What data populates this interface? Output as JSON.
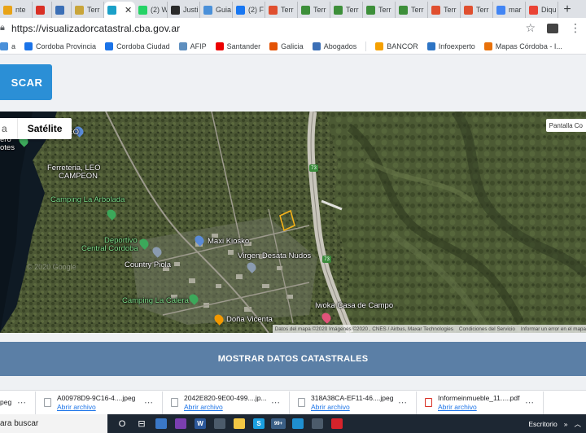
{
  "browser": {
    "tabs": [
      {
        "label": "nte",
        "icon": "tab-favicon",
        "color": "#e8a317",
        "active": false
      },
      {
        "label": "",
        "icon": "gmail-icon",
        "color": "#d93025",
        "active": false
      },
      {
        "label": "",
        "icon": "calendar-icon",
        "color": "#3b6fb6",
        "active": false
      },
      {
        "label": "Terr",
        "icon": "tab-favicon",
        "color": "#c9a53a",
        "active": false
      },
      {
        "label": "",
        "icon": "tab-favicon",
        "color": "#1aa0c8",
        "active": true
      },
      {
        "label": "(2) W",
        "icon": "whatsapp-icon",
        "color": "#25d366",
        "active": false
      },
      {
        "label": "Justi",
        "icon": "tab-favicon",
        "color": "#2a2a2a",
        "active": false
      },
      {
        "label": "Guia",
        "icon": "tab-favicon",
        "color": "#4a90d9",
        "active": false
      },
      {
        "label": "(2) F",
        "icon": "facebook-icon",
        "color": "#1877f2",
        "active": false
      },
      {
        "label": "Terr",
        "icon": "tab-favicon",
        "color": "#e04f2f",
        "active": false
      },
      {
        "label": "Terr",
        "icon": "tab-favicon",
        "color": "#3d8f3a",
        "active": false
      },
      {
        "label": "Terr",
        "icon": "tab-favicon",
        "color": "#3d8f3a",
        "active": false
      },
      {
        "label": "Terr",
        "icon": "tab-favicon",
        "color": "#3d8f3a",
        "active": false
      },
      {
        "label": "Terr",
        "icon": "tab-favicon",
        "color": "#3d8f3a",
        "active": false
      },
      {
        "label": "Terr",
        "icon": "tab-favicon",
        "color": "#e04f2f",
        "active": false
      },
      {
        "label": "Terr",
        "icon": "tab-favicon",
        "color": "#e04f2f",
        "active": false
      },
      {
        "label": "mar",
        "icon": "google-icon",
        "color": "#4285f4",
        "active": false
      },
      {
        "label": "Diqu",
        "icon": "maps-pin-icon",
        "color": "#ea4335",
        "active": false
      }
    ],
    "new_tab": "+",
    "url": "https://visualizadorcatastral.cba.gov.ar",
    "bookmarks": [
      {
        "label": "a",
        "color": "#4a90d9"
      },
      {
        "label": "Cordoba Provincia",
        "color": "#1a73e8"
      },
      {
        "label": "Cordoba Ciudad",
        "color": "#1a73e8"
      },
      {
        "label": "AFIP",
        "color": "#5f8fbf"
      },
      {
        "label": "Santander",
        "color": "#ec0000"
      },
      {
        "label": "Galicia",
        "color": "#e35205"
      },
      {
        "label": "Abogados",
        "color": "#3b6fb6"
      },
      {
        "label": "BANCOR",
        "color": "#f5a000"
      },
      {
        "label": "Infoexperto",
        "color": "#2d74c4"
      },
      {
        "label": "Mapas Córdoba - I...",
        "color": "#e8710a"
      }
    ]
  },
  "page": {
    "search_button": "SCAR",
    "map": {
      "type_unselected": "a",
      "type_selected": "Satélite",
      "fullscreen": "Pantalla Co",
      "labels": [
        {
          "text": "LEO",
          "style": ""
        },
        {
          "text": "Ferreteria, LEO",
          "style": ""
        },
        {
          "text": "CAMPEON",
          "style": ""
        },
        {
          "text": "Camping La Arbolada",
          "style": "green"
        },
        {
          "text": "Deportivo",
          "style": "green"
        },
        {
          "text": "Central Cordoba",
          "style": "green"
        },
        {
          "text": "Maxi Kiosko",
          "style": ""
        },
        {
          "text": "Virgen Desata Nudos",
          "style": ""
        },
        {
          "text": "Country Piola",
          "style": ""
        },
        {
          "text": "Camping La Calera",
          "style": "green"
        },
        {
          "text": "Doña Vicenta",
          "style": ""
        },
        {
          "text": "Iwoka Casa de Campo",
          "style": ""
        },
        {
          "text": "© 2020 Google",
          "style": "faint"
        },
        {
          "text": "ero",
          "style": ""
        },
        {
          "text": "otes",
          "style": ""
        }
      ],
      "route_shields": [
        "73",
        "73"
      ],
      "attribution": [
        "Datos del mapa ©2020 Imágenes ©2020 , CNES / Airbus, Maxar Technologies",
        "Condiciones del Servicio",
        "Informar un error en el mapa"
      ]
    },
    "show_data_button": "MOSTRAR DATOS CATASTRALES"
  },
  "downloads": [
    {
      "name": "peg",
      "open": ""
    },
    {
      "name": "A00978D9-9C16-4....jpeg",
      "open": "Abrir archivo"
    },
    {
      "name": "2042E820-9E00-499....jp...",
      "open": "Abrir archivo"
    },
    {
      "name": "318A38CA-EF11-46....jpeg",
      "open": "Abrir archivo"
    },
    {
      "name": "Informeinmueble_11.....pdf",
      "open": "Abrir archivo"
    }
  ],
  "taskbar": {
    "search_text": "ara buscar",
    "apps": [
      {
        "name": "cortana-icon",
        "glyph": "O",
        "color": ""
      },
      {
        "name": "task-view-icon",
        "glyph": "⊟",
        "color": ""
      },
      {
        "name": "calculator-icon",
        "glyph": "",
        "color": "#3a78c8"
      },
      {
        "name": "whatsapp-icon",
        "glyph": "",
        "color": "#7a3fb0"
      },
      {
        "name": "word-icon",
        "glyph": "W",
        "color": "#2b579a"
      },
      {
        "name": "phone-icon",
        "glyph": "",
        "color": "#4c5b6b"
      },
      {
        "name": "file-explorer-icon",
        "glyph": "",
        "color": "#f2c744"
      },
      {
        "name": "skype-icon",
        "glyph": "S",
        "color": "#1a9fe0"
      },
      {
        "name": "mail-icon",
        "glyph": "99+",
        "color": "#3b5f86"
      },
      {
        "name": "edge-icon",
        "glyph": "",
        "color": "#1f8fd0"
      },
      {
        "name": "phone-link-icon",
        "glyph": "",
        "color": "#4c5b6b"
      },
      {
        "name": "acrobat-icon",
        "glyph": "",
        "color": "#d5232b"
      }
    ],
    "tray_label": "Escritorio",
    "tray_chevron": "»"
  }
}
